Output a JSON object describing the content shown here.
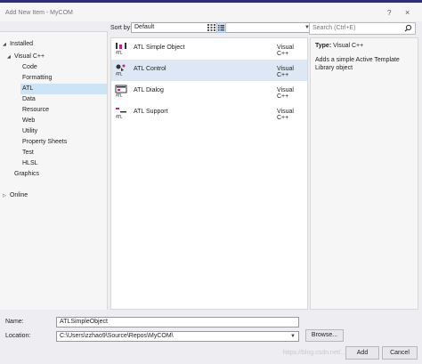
{
  "window": {
    "title": "Add New Item - MyCOM",
    "help_label": "?",
    "close_label": "×"
  },
  "tree": {
    "installed": "Installed",
    "visual_cpp": "Visual C++",
    "children": [
      "Code",
      "Formatting",
      "ATL",
      "Data",
      "Resource",
      "Web",
      "Utility",
      "Property Sheets",
      "Test",
      "HLSL"
    ],
    "graphics": "Graphics",
    "online": "Online"
  },
  "toolbar": {
    "sort_label": "Sort by:",
    "sort_value": "Default"
  },
  "search": {
    "placeholder": "Search (Ctrl+E)"
  },
  "templates": [
    {
      "name": "ATL Simple Object",
      "lang": "Visual C++"
    },
    {
      "name": "ATL Control",
      "lang": "Visual C++"
    },
    {
      "name": "ATL Dialog",
      "lang": "Visual C++"
    },
    {
      "name": "ATL Support",
      "lang": "Visual C++"
    }
  ],
  "description": {
    "type_label": "Type:",
    "type_value": "Visual C++",
    "text": "Adds a simple Active Template Library object"
  },
  "form": {
    "name_label": "Name:",
    "name_value": "ATLSimpleObject",
    "location_label": "Location:",
    "location_value": "C:\\Users\\zzhao9\\Source\\Repos\\MyCOM\\",
    "browse_label": "Browse...",
    "add_label": "Add",
    "cancel_label": "Cancel"
  },
  "watermark": "https://blog.csdn.net/..."
}
